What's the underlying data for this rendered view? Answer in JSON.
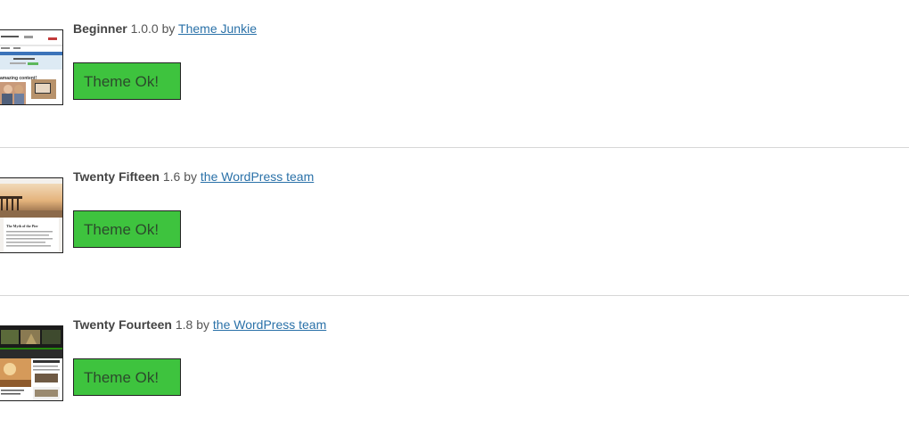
{
  "themes": [
    {
      "name": "Beginner",
      "version": "1.0.0",
      "by": "by",
      "author": "Theme Junkie",
      "status_label": "Theme Ok!"
    },
    {
      "name": "Twenty Fifteen",
      "version": "1.6",
      "by": "by",
      "author": "the WordPress team",
      "status_label": "Theme Ok!"
    },
    {
      "name": "Twenty Fourteen",
      "version": "1.8",
      "by": "by",
      "author": "the WordPress team",
      "status_label": "Theme Ok!"
    }
  ],
  "colors": {
    "ok_button": "#3ec33e",
    "link": "#2a71a8",
    "divider": "#d6d6d6"
  },
  "thumbnails": {
    "beginner": {
      "headline": "amazing content!"
    },
    "twentyfifteen": {
      "post_title": "The Myth of the Pier"
    }
  }
}
